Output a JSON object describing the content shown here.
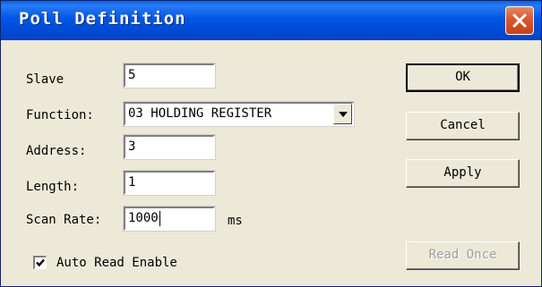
{
  "window": {
    "title": "Poll Definition"
  },
  "labels": {
    "slave": "Slave",
    "function": "Function:",
    "address": "Address:",
    "length": "Length:",
    "scan_rate": "Scan Rate:",
    "scan_rate_unit": "ms"
  },
  "fields": {
    "slave": "5",
    "function": "03 HOLDING REGISTER",
    "address": "3",
    "length": "1",
    "scan_rate": "1000"
  },
  "buttons": {
    "ok": "OK",
    "cancel": "Cancel",
    "apply": "Apply",
    "read_once": "Read Once"
  },
  "auto_read": {
    "label": "Auto Read Enable",
    "checked": true
  },
  "icons": {
    "close": "close-icon",
    "dropdown": "chevron-down-icon",
    "check": "check-icon"
  }
}
